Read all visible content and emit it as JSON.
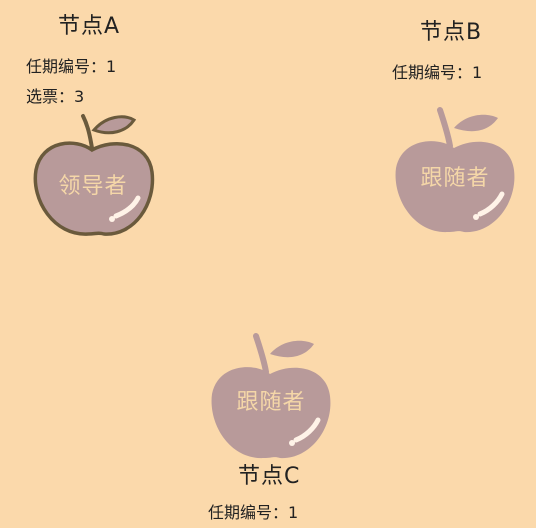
{
  "node_a": {
    "title": "节点A",
    "term": "任期编号：1",
    "votes": "选票：3",
    "role": "领导者",
    "state": "leader"
  },
  "node_b": {
    "title": "节点B",
    "term": "任期编号：1",
    "role": "跟随者",
    "state": "follower"
  },
  "node_c": {
    "title": "节点C",
    "term": "任期编号：1",
    "role": "跟随者",
    "state": "follower"
  },
  "colors": {
    "background": "#fbd9ab",
    "apple": "#b89a9a",
    "apple_outline": "#6a5a3c",
    "label": "#f5d7a8",
    "highlight": "#fff3e8"
  }
}
